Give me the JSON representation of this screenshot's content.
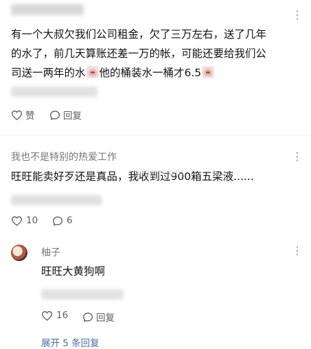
{
  "more_glyph": "⋮",
  "comment1": {
    "text_line1": "有一个大叔欠我们公司租金，欠了三万左右，送了几年",
    "text_line2": "的水了，前几天算账还差一万的帐，可能还要给我们公",
    "text_line3_a": "司送一两年的水",
    "text_line3_b": "他的桶装水一桶才6.5",
    "like_label": "赞",
    "reply_label": "回复"
  },
  "comment2": {
    "username": "我也不是特别的热爱工作",
    "text": "旺旺能卖好歹还是真品，我收到过900箱五梁液......",
    "watermark": "@gamingjps",
    "like_count": "10",
    "reply_count": "6"
  },
  "reply1": {
    "username": "柚子",
    "text": "旺旺大黄狗啊",
    "like_count": "16",
    "reply_label": "回复"
  },
  "expand_label": "展开 5 条回复",
  "icons": [
    "heart-icon",
    "comment-bubble-icon",
    "more-vertical-icon",
    "laughing-emoji-icon"
  ]
}
